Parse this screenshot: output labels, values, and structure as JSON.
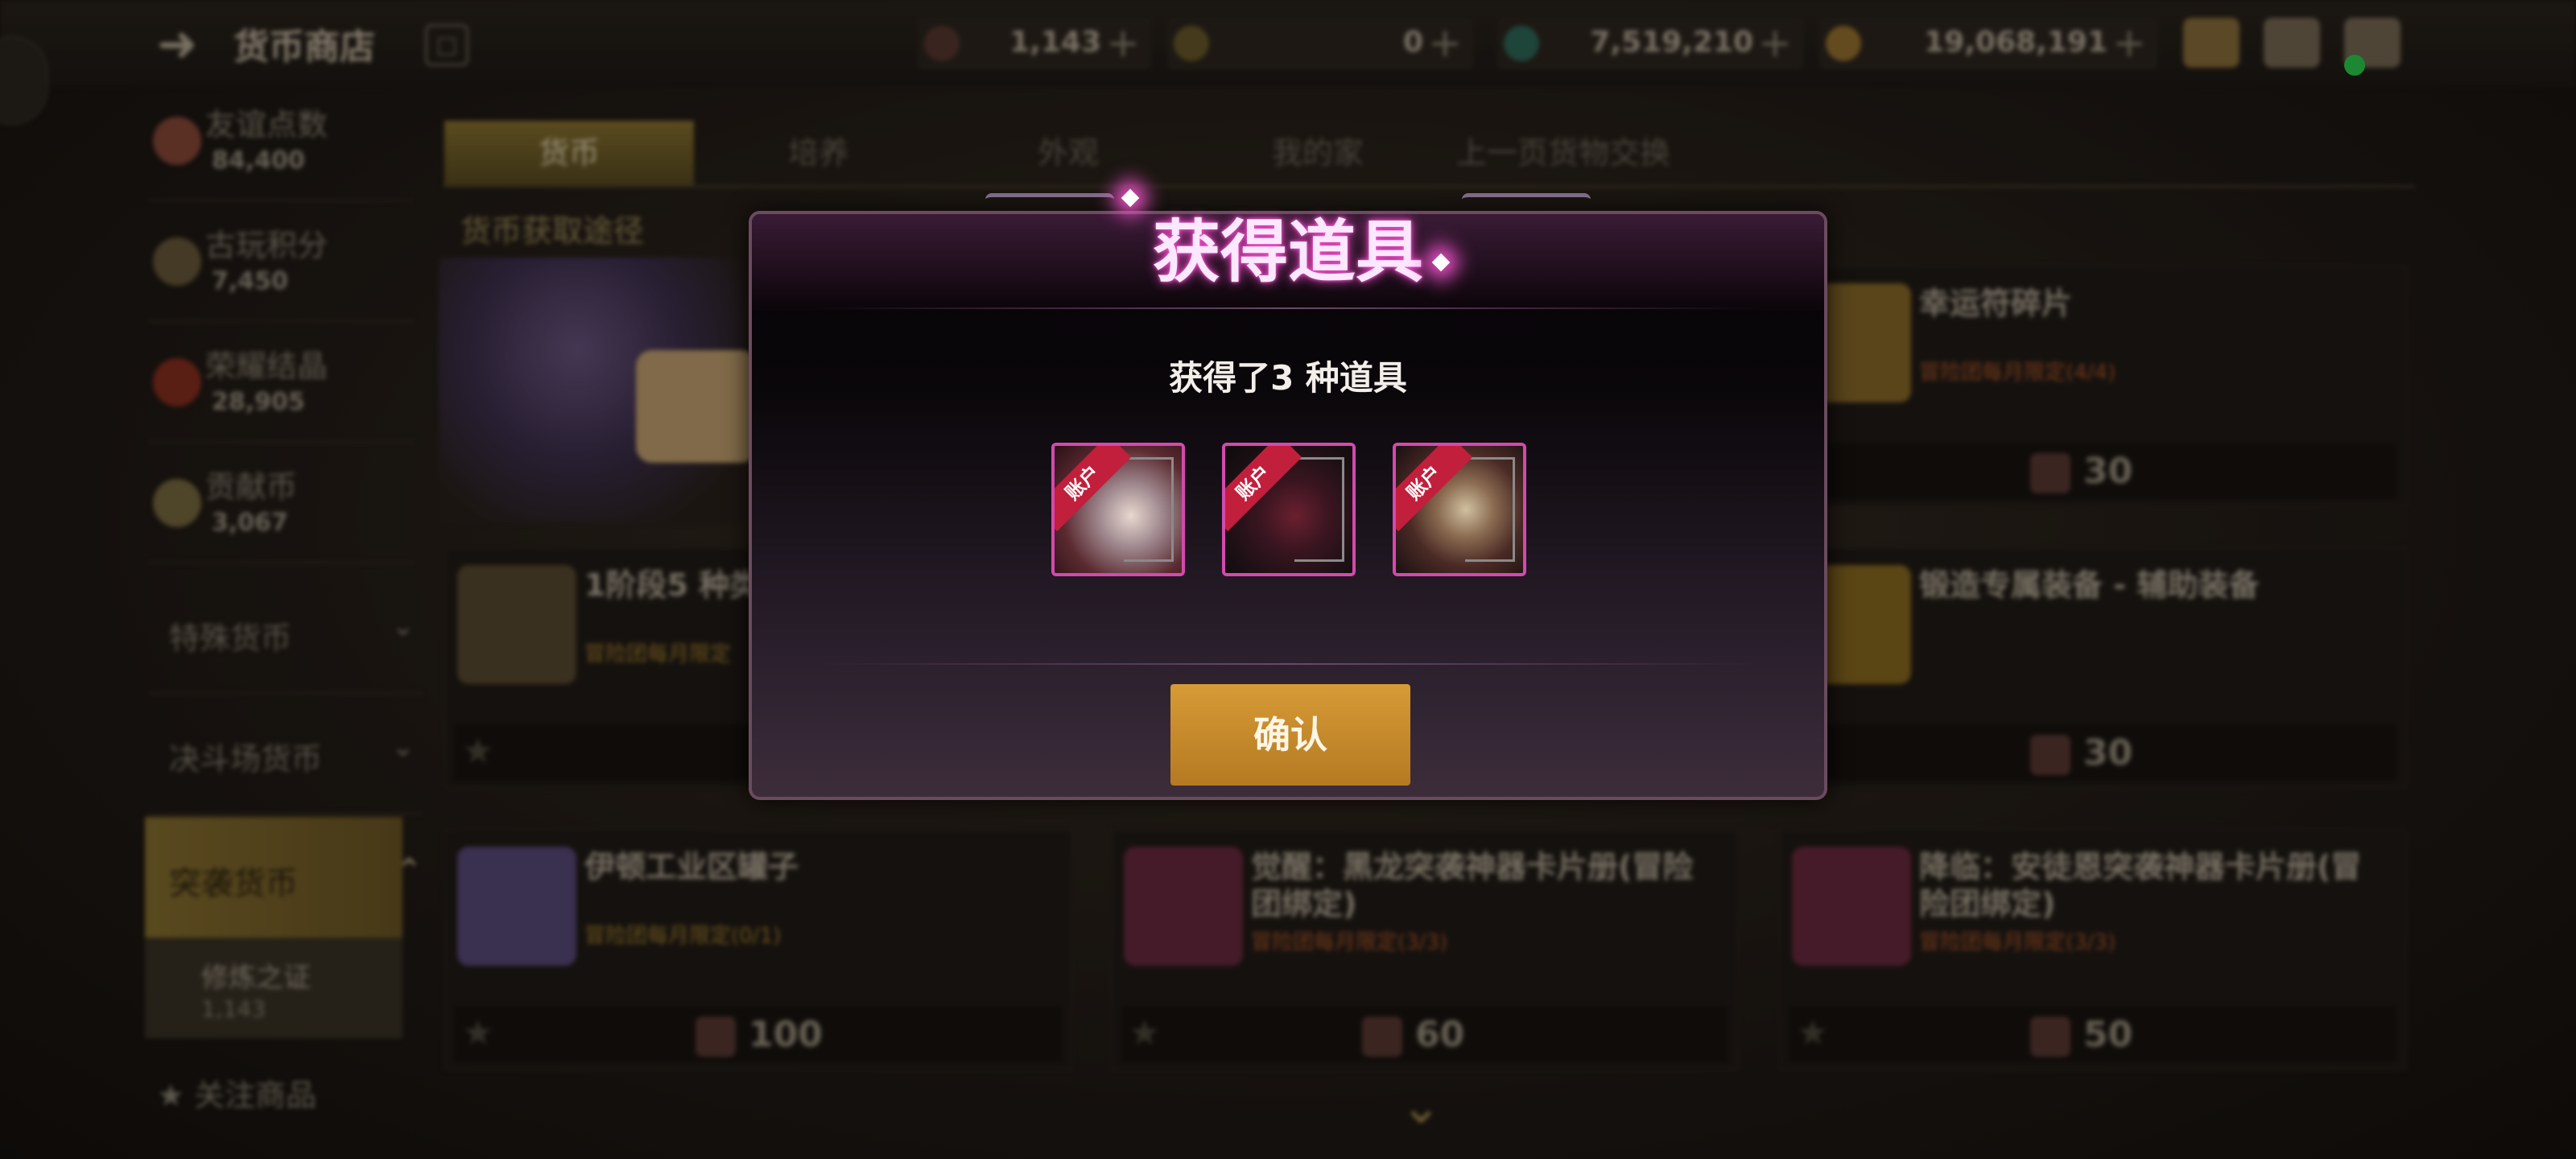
{
  "header": {
    "title": "货币商店",
    "back_icon": "back-arrow-icon"
  },
  "currencies": [
    {
      "icon": "trial-token-icon",
      "value": "1,143",
      "plus": "+"
    },
    {
      "icon": "moon-icon",
      "value": "0",
      "plus": "+"
    },
    {
      "icon": "crystal-icon",
      "value": "7,519,210",
      "plus": "+"
    },
    {
      "icon": "gold-coin-icon",
      "value": "19,068,191",
      "plus": "+"
    }
  ],
  "sidebar": {
    "items": [
      {
        "label": "友谊点数",
        "value": "84,400"
      },
      {
        "label": "古玩积分",
        "value": "7,450"
      },
      {
        "label": "荣耀结晶",
        "value": "28,905"
      },
      {
        "label": "贡献币",
        "value": "3,067"
      }
    ],
    "sections": [
      {
        "label": "特殊货币",
        "chevron": "⌄"
      },
      {
        "label": "决斗场货币",
        "chevron": "⌄"
      }
    ],
    "active": {
      "label": "突袭货币",
      "chevron": "⌃"
    },
    "sub_item": {
      "label": "修炼之证",
      "value": "1,143"
    },
    "favorite": {
      "label": "关注商品",
      "icon": "★"
    }
  },
  "tabs": [
    "货币",
    "培养",
    "外观",
    "我的家",
    "上一页货物交换"
  ],
  "active_tab": 0,
  "sub_title": "货币获取途径",
  "cards": [
    {
      "name": "幸运符碎片",
      "limit": "冒险团每月限定(4/4)",
      "price": "30"
    },
    {
      "name": "1阶段5 种类",
      "limit": "冒险团每月限定",
      "price": ""
    },
    {
      "name": "锻造专属装备 - 辅助装备",
      "limit": "",
      "price": "30"
    },
    {
      "name": "伊顿工业区罐子",
      "limit": "冒险团每月限定(0/1)",
      "price": "100"
    },
    {
      "name": "觉醒：黑龙突袭神器卡片册(冒险团绑定)",
      "limit": "冒险团每月限定(3/3)",
      "price": "60"
    },
    {
      "name": "降临：安徒恩突袭神器卡片册(冒险团绑定)",
      "limit": "冒险团每月限定(3/3)",
      "price": "50"
    }
  ],
  "modal": {
    "title": "获得道具",
    "subtitle": "获得了3 种道具",
    "items": [
      {
        "badge": "账户",
        "icon": "white-haired-girl-card-icon"
      },
      {
        "badge": "账户",
        "icon": "dark-armor-card-icon"
      },
      {
        "badge": "账户",
        "icon": "dragon-knight-card-icon"
      }
    ],
    "confirm_label": "确认"
  },
  "colors": {
    "accent_gold": "#c88c2c",
    "modal_border": "#d24aae",
    "title_glow": "#ff4bd2"
  }
}
